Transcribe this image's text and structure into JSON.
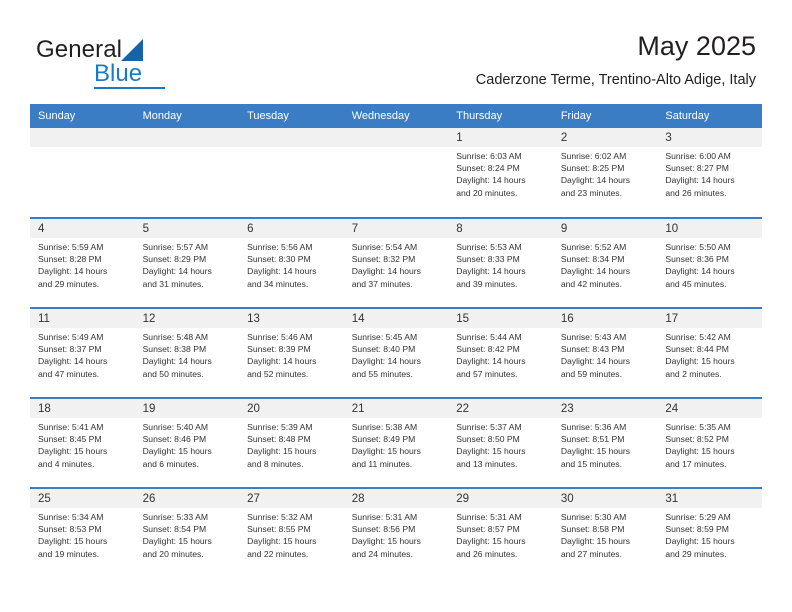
{
  "brand": {
    "name_part1": "General",
    "name_part2": "Blue",
    "triangle_color": "#1763a9",
    "blue_color": "#1a7ac4"
  },
  "header": {
    "title": "May 2025",
    "subtitle": "Caderzone Terme, Trentino-Alto Adige, Italy"
  },
  "theme": {
    "header_bar_color": "#3b7dc4",
    "day_strip_color": "#f1f1f1",
    "text_color": "#333333"
  },
  "weekdays": [
    "Sunday",
    "Monday",
    "Tuesday",
    "Wednesday",
    "Thursday",
    "Friday",
    "Saturday"
  ],
  "labels": {
    "sunrise": "Sunrise:",
    "sunset": "Sunset:",
    "daylight": "Daylight:"
  },
  "weeks": [
    [
      {
        "day": "",
        "empty": true
      },
      {
        "day": "",
        "empty": true
      },
      {
        "day": "",
        "empty": true
      },
      {
        "day": "",
        "empty": true
      },
      {
        "day": "1",
        "sunrise": "Sunrise: 6:03 AM",
        "sunset": "Sunset: 8:24 PM",
        "daylight_l1": "Daylight: 14 hours",
        "daylight_l2": "and 20 minutes."
      },
      {
        "day": "2",
        "sunrise": "Sunrise: 6:02 AM",
        "sunset": "Sunset: 8:25 PM",
        "daylight_l1": "Daylight: 14 hours",
        "daylight_l2": "and 23 minutes."
      },
      {
        "day": "3",
        "sunrise": "Sunrise: 6:00 AM",
        "sunset": "Sunset: 8:27 PM",
        "daylight_l1": "Daylight: 14 hours",
        "daylight_l2": "and 26 minutes."
      }
    ],
    [
      {
        "day": "4",
        "sunrise": "Sunrise: 5:59 AM",
        "sunset": "Sunset: 8:28 PM",
        "daylight_l1": "Daylight: 14 hours",
        "daylight_l2": "and 29 minutes."
      },
      {
        "day": "5",
        "sunrise": "Sunrise: 5:57 AM",
        "sunset": "Sunset: 8:29 PM",
        "daylight_l1": "Daylight: 14 hours",
        "daylight_l2": "and 31 minutes."
      },
      {
        "day": "6",
        "sunrise": "Sunrise: 5:56 AM",
        "sunset": "Sunset: 8:30 PM",
        "daylight_l1": "Daylight: 14 hours",
        "daylight_l2": "and 34 minutes."
      },
      {
        "day": "7",
        "sunrise": "Sunrise: 5:54 AM",
        "sunset": "Sunset: 8:32 PM",
        "daylight_l1": "Daylight: 14 hours",
        "daylight_l2": "and 37 minutes."
      },
      {
        "day": "8",
        "sunrise": "Sunrise: 5:53 AM",
        "sunset": "Sunset: 8:33 PM",
        "daylight_l1": "Daylight: 14 hours",
        "daylight_l2": "and 39 minutes."
      },
      {
        "day": "9",
        "sunrise": "Sunrise: 5:52 AM",
        "sunset": "Sunset: 8:34 PM",
        "daylight_l1": "Daylight: 14 hours",
        "daylight_l2": "and 42 minutes."
      },
      {
        "day": "10",
        "sunrise": "Sunrise: 5:50 AM",
        "sunset": "Sunset: 8:36 PM",
        "daylight_l1": "Daylight: 14 hours",
        "daylight_l2": "and 45 minutes."
      }
    ],
    [
      {
        "day": "11",
        "sunrise": "Sunrise: 5:49 AM",
        "sunset": "Sunset: 8:37 PM",
        "daylight_l1": "Daylight: 14 hours",
        "daylight_l2": "and 47 minutes."
      },
      {
        "day": "12",
        "sunrise": "Sunrise: 5:48 AM",
        "sunset": "Sunset: 8:38 PM",
        "daylight_l1": "Daylight: 14 hours",
        "daylight_l2": "and 50 minutes."
      },
      {
        "day": "13",
        "sunrise": "Sunrise: 5:46 AM",
        "sunset": "Sunset: 8:39 PM",
        "daylight_l1": "Daylight: 14 hours",
        "daylight_l2": "and 52 minutes."
      },
      {
        "day": "14",
        "sunrise": "Sunrise: 5:45 AM",
        "sunset": "Sunset: 8:40 PM",
        "daylight_l1": "Daylight: 14 hours",
        "daylight_l2": "and 55 minutes."
      },
      {
        "day": "15",
        "sunrise": "Sunrise: 5:44 AM",
        "sunset": "Sunset: 8:42 PM",
        "daylight_l1": "Daylight: 14 hours",
        "daylight_l2": "and 57 minutes."
      },
      {
        "day": "16",
        "sunrise": "Sunrise: 5:43 AM",
        "sunset": "Sunset: 8:43 PM",
        "daylight_l1": "Daylight: 14 hours",
        "daylight_l2": "and 59 minutes."
      },
      {
        "day": "17",
        "sunrise": "Sunrise: 5:42 AM",
        "sunset": "Sunset: 8:44 PM",
        "daylight_l1": "Daylight: 15 hours",
        "daylight_l2": "and 2 minutes."
      }
    ],
    [
      {
        "day": "18",
        "sunrise": "Sunrise: 5:41 AM",
        "sunset": "Sunset: 8:45 PM",
        "daylight_l1": "Daylight: 15 hours",
        "daylight_l2": "and 4 minutes."
      },
      {
        "day": "19",
        "sunrise": "Sunrise: 5:40 AM",
        "sunset": "Sunset: 8:46 PM",
        "daylight_l1": "Daylight: 15 hours",
        "daylight_l2": "and 6 minutes."
      },
      {
        "day": "20",
        "sunrise": "Sunrise: 5:39 AM",
        "sunset": "Sunset: 8:48 PM",
        "daylight_l1": "Daylight: 15 hours",
        "daylight_l2": "and 8 minutes."
      },
      {
        "day": "21",
        "sunrise": "Sunrise: 5:38 AM",
        "sunset": "Sunset: 8:49 PM",
        "daylight_l1": "Daylight: 15 hours",
        "daylight_l2": "and 11 minutes."
      },
      {
        "day": "22",
        "sunrise": "Sunrise: 5:37 AM",
        "sunset": "Sunset: 8:50 PM",
        "daylight_l1": "Daylight: 15 hours",
        "daylight_l2": "and 13 minutes."
      },
      {
        "day": "23",
        "sunrise": "Sunrise: 5:36 AM",
        "sunset": "Sunset: 8:51 PM",
        "daylight_l1": "Daylight: 15 hours",
        "daylight_l2": "and 15 minutes."
      },
      {
        "day": "24",
        "sunrise": "Sunrise: 5:35 AM",
        "sunset": "Sunset: 8:52 PM",
        "daylight_l1": "Daylight: 15 hours",
        "daylight_l2": "and 17 minutes."
      }
    ],
    [
      {
        "day": "25",
        "sunrise": "Sunrise: 5:34 AM",
        "sunset": "Sunset: 8:53 PM",
        "daylight_l1": "Daylight: 15 hours",
        "daylight_l2": "and 19 minutes."
      },
      {
        "day": "26",
        "sunrise": "Sunrise: 5:33 AM",
        "sunset": "Sunset: 8:54 PM",
        "daylight_l1": "Daylight: 15 hours",
        "daylight_l2": "and 20 minutes."
      },
      {
        "day": "27",
        "sunrise": "Sunrise: 5:32 AM",
        "sunset": "Sunset: 8:55 PM",
        "daylight_l1": "Daylight: 15 hours",
        "daylight_l2": "and 22 minutes."
      },
      {
        "day": "28",
        "sunrise": "Sunrise: 5:31 AM",
        "sunset": "Sunset: 8:56 PM",
        "daylight_l1": "Daylight: 15 hours",
        "daylight_l2": "and 24 minutes."
      },
      {
        "day": "29",
        "sunrise": "Sunrise: 5:31 AM",
        "sunset": "Sunset: 8:57 PM",
        "daylight_l1": "Daylight: 15 hours",
        "daylight_l2": "and 26 minutes."
      },
      {
        "day": "30",
        "sunrise": "Sunrise: 5:30 AM",
        "sunset": "Sunset: 8:58 PM",
        "daylight_l1": "Daylight: 15 hours",
        "daylight_l2": "and 27 minutes."
      },
      {
        "day": "31",
        "sunrise": "Sunrise: 5:29 AM",
        "sunset": "Sunset: 8:59 PM",
        "daylight_l1": "Daylight: 15 hours",
        "daylight_l2": "and 29 minutes."
      }
    ]
  ]
}
